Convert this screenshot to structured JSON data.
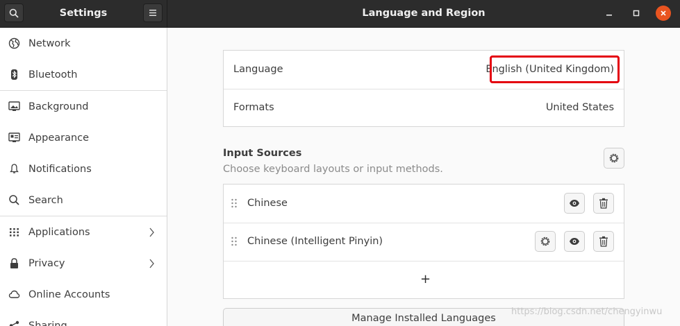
{
  "window": {
    "sidebar_title": "Settings",
    "panel_title": "Language and Region"
  },
  "sidebar": {
    "items": [
      {
        "label": "Network",
        "icon": "network-icon"
      },
      {
        "label": "Bluetooth",
        "icon": "bluetooth-icon"
      },
      {
        "label": "Background",
        "icon": "background-icon"
      },
      {
        "label": "Appearance",
        "icon": "appearance-icon"
      },
      {
        "label": "Notifications",
        "icon": "bell-icon"
      },
      {
        "label": "Search",
        "icon": "search-icon"
      },
      {
        "label": "Applications",
        "icon": "applications-icon",
        "has_submenu": true
      },
      {
        "label": "Privacy",
        "icon": "lock-icon",
        "has_submenu": true
      },
      {
        "label": "Online Accounts",
        "icon": "cloud-icon"
      },
      {
        "label": "Sharing",
        "icon": "share-icon"
      }
    ]
  },
  "language_panel": {
    "language_label": "Language",
    "language_value": "English (United Kingdom)",
    "formats_label": "Formats",
    "formats_value": "United States"
  },
  "input_sources": {
    "title": "Input Sources",
    "subtitle": "Choose keyboard layouts or input methods.",
    "sources": [
      {
        "label": "Chinese",
        "has_settings": false
      },
      {
        "label": "Chinese (Intelligent Pinyin)",
        "has_settings": true
      }
    ],
    "add_symbol": "+"
  },
  "manage_button": "Manage Installed Languages",
  "watermark": "https://blog.csdn.net/chengyinwu",
  "colors": {
    "header_bg": "#2c2c2c",
    "close_button": "#e95420",
    "highlight": "#e4000f"
  }
}
